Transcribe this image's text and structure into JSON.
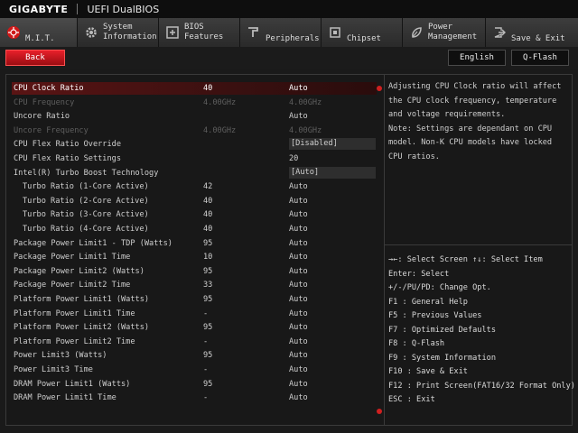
{
  "titlebar": {
    "logo": "GIGABYTE",
    "app_title": "UEFI DualBIOS"
  },
  "tabs": [
    {
      "label": "M.I.T.",
      "icon": "mit-icon",
      "active": true
    },
    {
      "label": "System\nInformation",
      "icon": "gear-icon",
      "active": false
    },
    {
      "label": "BIOS\nFeatures",
      "icon": "bios-features-icon",
      "active": false
    },
    {
      "label": "Peripherals",
      "icon": "peripherals-icon",
      "active": false
    },
    {
      "label": "Chipset",
      "icon": "chipset-icon",
      "active": false
    },
    {
      "label": "Power\nManagement",
      "icon": "power-icon",
      "active": false
    },
    {
      "label": "Save & Exit",
      "icon": "exit-icon",
      "active": false
    }
  ],
  "actions": {
    "back": "Back",
    "language": "English",
    "qflash": "Q-Flash"
  },
  "settings": [
    {
      "label": "CPU Clock Ratio",
      "current": "40",
      "value": "Auto",
      "state": "selected"
    },
    {
      "label": "CPU Frequency",
      "current": "4.00GHz",
      "value": "4.00GHz",
      "state": "dim"
    },
    {
      "label": "Uncore Ratio",
      "current": "",
      "value": "Auto",
      "state": "normal"
    },
    {
      "label": "Uncore Frequency",
      "current": "4.00GHz",
      "value": "4.00GHz",
      "state": "dim"
    },
    {
      "label": "CPU Flex Ratio Override",
      "current": "",
      "value": "[Disabled]",
      "state": "box"
    },
    {
      "label": "CPU Flex Ratio Settings",
      "current": "",
      "value": "20",
      "state": "normal"
    },
    {
      "label": "Intel(R) Turbo Boost Technology",
      "current": "",
      "value": "[Auto]",
      "state": "box"
    },
    {
      "label": "Turbo Ratio (1-Core Active)",
      "current": "42",
      "value": "Auto",
      "state": "indent"
    },
    {
      "label": "Turbo Ratio (2-Core Active)",
      "current": "40",
      "value": "Auto",
      "state": "indent"
    },
    {
      "label": "Turbo Ratio (3-Core Active)",
      "current": "40",
      "value": "Auto",
      "state": "indent"
    },
    {
      "label": "Turbo Ratio (4-Core Active)",
      "current": "40",
      "value": "Auto",
      "state": "indent"
    },
    {
      "label": "Package Power Limit1 - TDP (Watts)",
      "current": "95",
      "value": "Auto",
      "state": "normal"
    },
    {
      "label": "Package Power Limit1 Time",
      "current": "10",
      "value": "Auto",
      "state": "normal"
    },
    {
      "label": "Package Power Limit2 (Watts)",
      "current": "95",
      "value": "Auto",
      "state": "normal"
    },
    {
      "label": "Package Power Limit2 Time",
      "current": "33",
      "value": "Auto",
      "state": "normal"
    },
    {
      "label": "Platform Power Limit1 (Watts)",
      "current": "95",
      "value": "Auto",
      "state": "normal"
    },
    {
      "label": "Platform Power Limit1 Time",
      "current": "-",
      "value": "Auto",
      "state": "normal"
    },
    {
      "label": "Platform Power Limit2 (Watts)",
      "current": "95",
      "value": "Auto",
      "state": "normal"
    },
    {
      "label": "Platform Power Limit2 Time",
      "current": "-",
      "value": "Auto",
      "state": "normal"
    },
    {
      "label": "Power Limit3 (Watts)",
      "current": "95",
      "value": "Auto",
      "state": "normal"
    },
    {
      "label": "Power Limit3 Time",
      "current": "-",
      "value": "Auto",
      "state": "normal"
    },
    {
      "label": "DRAM Power Limit1 (Watts)",
      "current": "95",
      "value": "Auto",
      "state": "normal"
    },
    {
      "label": "DRAM Power Limit1 Time",
      "current": "-",
      "value": "Auto",
      "state": "normal"
    }
  ],
  "help": {
    "text": "Adjusting CPU Clock ratio will affect the CPU clock frequency, temperature and voltage requirements.\nNote: Settings are dependant  on  CPU model. Non-K CPU models have locked CPU ratios."
  },
  "keys": [
    "→←: Select Screen  ↑↓: Select Item",
    "Enter: Select",
    "+/-/PU/PD: Change Opt.",
    "F1  : General Help",
    "F5  : Previous Values",
    "F7  : Optimized Defaults",
    "F8  : Q-Flash",
    "F9  : System Information",
    "F10 : Save & Exit",
    "F12 : Print Screen(FAT16/32 Format Only)",
    "ESC : Exit"
  ],
  "colors": {
    "accent": "#d02020",
    "background": "#1a1a1a",
    "selected_row": "#5a1414"
  }
}
